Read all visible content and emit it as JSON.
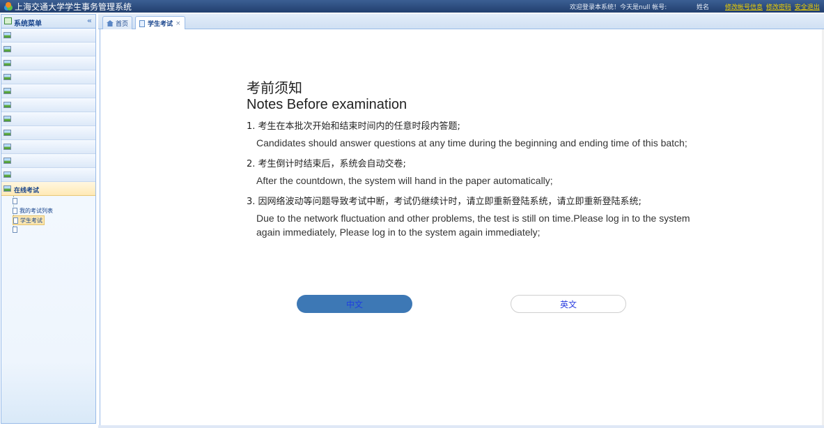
{
  "header": {
    "app_title": "上海交通大学学生事务管理系统",
    "welcome": "欢迎登录本系统！今天是null 帐号:",
    "name_label": "姓名",
    "links": [
      "修改帐号信息",
      "修改密码",
      "安全退出"
    ],
    "link_color": "#f2d200"
  },
  "sidebar": {
    "title": "系统菜单",
    "collapse_icon": "«",
    "items_count_note": "",
    "active_group": "在线考试",
    "tree": [
      {
        "label": ""
      },
      {
        "label": "我的考试列表"
      },
      {
        "label": "学生考试"
      },
      {
        "label": ""
      }
    ]
  },
  "tabs": [
    {
      "label": "首页",
      "icon": "home-icon"
    },
    {
      "label": "学生考试",
      "icon": "doc-icon",
      "close": "×"
    }
  ],
  "notes": {
    "title_cn": "考前须知",
    "title_en": "Notes Before examination",
    "items": [
      {
        "cn": "1. 考生在本批次开始和结束时间内的任意时段内答题;",
        "en": "Candidates should answer questions at any time during the beginning and ending time of this batch;"
      },
      {
        "cn": "2. 考生倒计时结束后，系统会自动交卷;",
        "en": "After the countdown, the system will hand in the paper automatically;"
      },
      {
        "cn": "3. 因网络波动等问题导致考试中断，考试仍继续计时，请立即重新登陆系统，请立即重新登陆系统;",
        "en": "Due to the network fluctuation and other problems, the test is still on time.Please log in to the system again immediately, Please log in to the system again immediately;"
      }
    ]
  },
  "buttons": {
    "chinese": "中文",
    "english": "英文",
    "accent": "#3d78b5"
  }
}
